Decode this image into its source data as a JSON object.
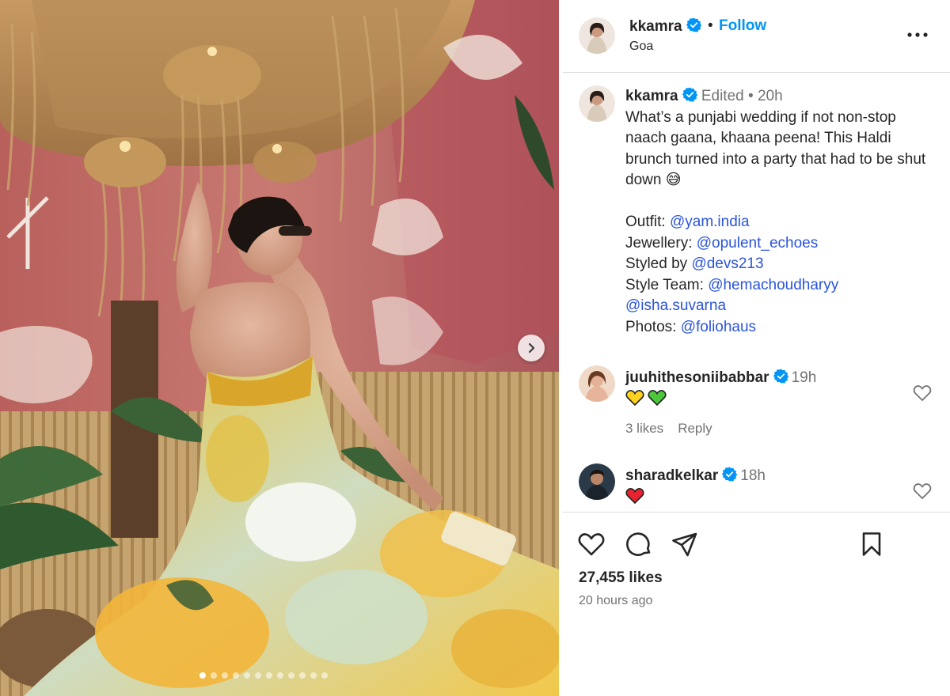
{
  "post": {
    "username": "kkamra",
    "follow_label": "Follow",
    "separator": "•",
    "location": "Goa",
    "more_label": "More options"
  },
  "caption": {
    "username": "kkamra",
    "edited": "Edited",
    "time": "20h",
    "text": "What’s a punjabi wedding if not non-stop naach gaana, khaana peena! This Haldi brunch turned into a party that had to be shut down 😅",
    "credits": [
      {
        "label": "Outfit: ",
        "handle": "@yam.india"
      },
      {
        "label": "Jewellery: ",
        "handle": "@opulent_echoes"
      },
      {
        "label": "Styled by ",
        "handle": "@devs213"
      },
      {
        "label": "Style Team: ",
        "handle": "@hemachoudharyy"
      },
      {
        "label": "",
        "handle": "@isha.suvarna"
      },
      {
        "label": "Photos: ",
        "handle": "@foliohaus"
      }
    ]
  },
  "comments": [
    {
      "username": "juuhithesoniibabbar",
      "time": "19h",
      "emojis": [
        "yellow-heart",
        "green-heart"
      ],
      "likes": "3 likes",
      "reply": "Reply"
    },
    {
      "username": "sharadkelkar",
      "time": "18h",
      "emojis": [
        "red-heart"
      ]
    }
  ],
  "engagement": {
    "likes": "27,455 likes",
    "posted": "20 hours ago"
  },
  "carousel": {
    "total_slides": 12,
    "active_index": 0
  },
  "colors": {
    "follow": "#0095f6",
    "verified": "#0095f6",
    "link": "#2b54d9",
    "muted": "#737373"
  }
}
